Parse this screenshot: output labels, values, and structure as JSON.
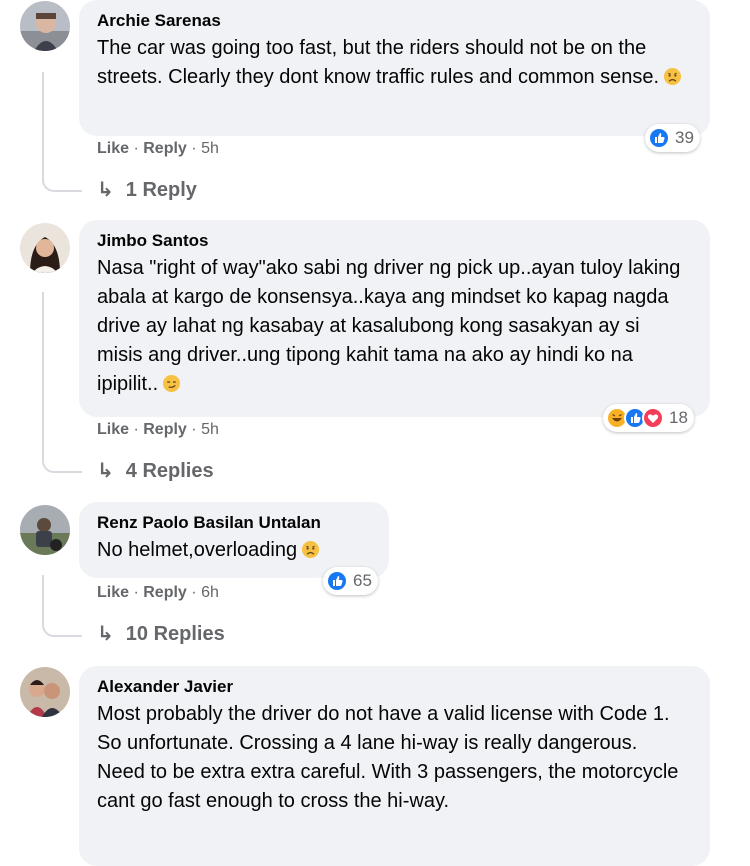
{
  "comments": [
    {
      "author": "Archie Sarenas",
      "text": "The car was going too fast, but the riders should not be on the streets. Clearly they dont know traffic rules and common sense.",
      "emoji": "sad-face-emoji",
      "like": "Like",
      "dot1": "·",
      "reply": "Reply",
      "dot2": "·",
      "time": "5h",
      "reaction_count": "39",
      "reactions": [
        "like-icon"
      ],
      "replies_label": "1 Reply"
    },
    {
      "author": "Jimbo Santos",
      "text": "Nasa \"right of way\"ako sabi ng driver ng pick up..ayan tuloy laking abala at kargo de konsensya..kaya ang mindset ko kapag nagda drive ay lahat ng kasabay at kasalubong kong sasakyan ay si misis ang driver..ung tipong kahit tama na ako ay hindi ko na ipipilit..",
      "emoji": "smirk-face-emoji",
      "like": "Like",
      "dot1": "·",
      "reply": "Reply",
      "dot2": "·",
      "time": "5h",
      "reaction_count": "18",
      "reactions": [
        "haha-icon",
        "like-icon",
        "love-icon"
      ],
      "replies_label": "4 Replies"
    },
    {
      "author": "Renz Paolo Basilan Untalan",
      "text": "No helmet,overloading",
      "emoji": "sad-face-emoji",
      "like": "Like",
      "dot1": "·",
      "reply": "Reply",
      "dot2": "·",
      "time": "6h",
      "reaction_count": "65",
      "reactions": [
        "like-icon"
      ],
      "replies_label": "10 Replies"
    },
    {
      "author": "Alexander Javier",
      "text": "Most probably the driver do not have a valid license with Code 1. So unfortunate. Crossing a 4 lane hi-way is really dangerous. Need to be extra extra careful. With 3 passengers, the motorcycle cant go fast enough to cross the hi-way."
    }
  ],
  "colors": {
    "bubble": "#f0f2f5",
    "meta": "#65676b",
    "like_blue": "#1877f2",
    "love_red": "#f33e58",
    "haha_yellow": "#f7b125"
  }
}
